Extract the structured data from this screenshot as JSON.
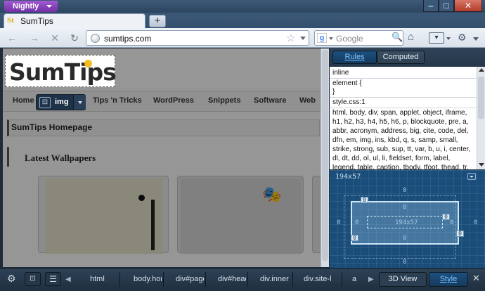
{
  "titlebar": {
    "app_button": "Nightly",
    "min": "–",
    "max": "□",
    "close": "✕"
  },
  "tab": {
    "favicon": "St",
    "title": "SumTips",
    "new_tab": "+"
  },
  "nav": {
    "back": "←",
    "forward": "→",
    "stop": "✕",
    "reload": "↻",
    "url": "sumtips.com",
    "star": "☆",
    "search_engine": "g",
    "search_placeholder": "Google",
    "search_icon": "🔍",
    "home": "⌂",
    "bookmarks": "▾",
    "extension": "⚙"
  },
  "page": {
    "logo": "SumTips",
    "menu": [
      "Home",
      "Tips 'n Tricks",
      "WordPress",
      "Snippets",
      "Software",
      "Web"
    ],
    "inspector": {
      "icon": "⊡",
      "label": "img"
    },
    "section1": "SumTips Homepage",
    "section2": "Latest Wallpapers",
    "masks": "🎭"
  },
  "sidebar": {
    "tabs": {
      "rules": "Rules",
      "computed": "Computed"
    },
    "rules": [
      "inline",
      "element {",
      "}",
      "style.css:1",
      "html, body, div, span, applet, object, iframe,",
      "h1, h2, h3, h4, h5, h6, p, blockquote, pre, a,",
      "abbr, acronym, address, big, cite, code, del,",
      "dfn, em, img, ins, kbd, q, s, samp, small,",
      "strike, strong, sub, sup, tt, var, b, u, i, center,",
      "dl, dt, dd, ol, ul, li, fieldset, form, label,",
      "legend, table, caption, tbody, tfoot, thead, tr,"
    ],
    "layout": {
      "title": "194x57",
      "content": "194x57",
      "margin_top": "0",
      "margin_left": "0",
      "margin_right": "0",
      "margin_bottom": "0",
      "border_top": "0",
      "border_left": "0",
      "border_right": "0",
      "border_bottom": "0",
      "padding_left": "0",
      "padding_right": "0",
      "handles": [
        "0",
        "0",
        "0",
        "0"
      ]
    }
  },
  "bottom": {
    "gear": "⚙",
    "inspect": "⊡",
    "list": "☰",
    "prev": "◀",
    "next": "▶",
    "breadcrumbs": [
      "html",
      "body.hor",
      "div#page",
      "div#head",
      "div.inner",
      "div.site-l",
      "a"
    ],
    "view_3d": "3D View",
    "style": "Style",
    "close": "✕"
  }
}
